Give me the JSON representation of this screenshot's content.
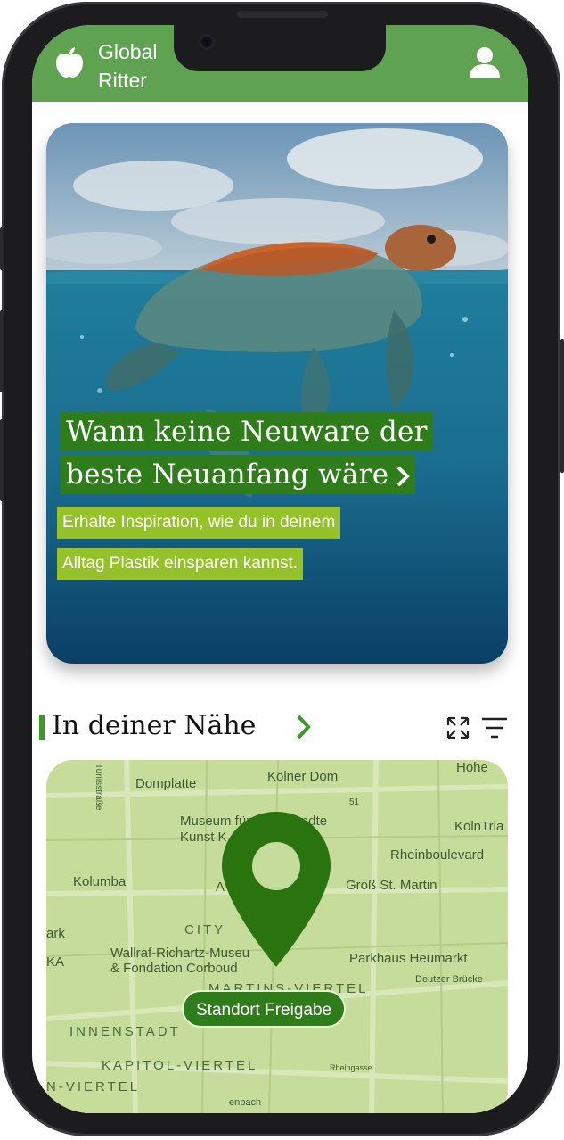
{
  "app": {
    "title_line1": "Global",
    "title_line2": "Ritter"
  },
  "icons": {
    "logo": "apple-icon",
    "profile": "user-icon",
    "hero_more": "chevron-right-icon",
    "section_more": "chevron-right-icon",
    "expand": "expand-icon",
    "filter": "filter-icon",
    "location": "map-pin-icon"
  },
  "hero": {
    "title_line1": "Wann keine Neuware der",
    "title_line2": "beste Neuanfang wäre",
    "subtitle_line1": "Erhalte Inspiration, wie du in deinem",
    "subtitle_line2": "Alltag Plastik einsparen kannst."
  },
  "section": {
    "title": "In deiner Nähe"
  },
  "map": {
    "labels": {
      "domplatte": "Domplatte",
      "koelner_dom": "Kölner Dom",
      "museum1": "Museum für",
      "museum1b": "vandte",
      "museum2": "Kunst K",
      "koelntri": "KölnTria",
      "rheinboulevard": "Rheinboulevard",
      "kolumba": "Kolumba",
      "altmarkt": "A",
      "altmarkt2": "arkt",
      "gross_st_martin": "Groß St. Martin",
      "city": "CITY",
      "mark": "ark",
      "wallraf1": "Wallraf-Richartz-Museu",
      "wallraf2": "& Fondation Corboud",
      "parkhaus": "Parkhaus Heumarkt",
      "martins": "MARTINS-VIERTEL",
      "deutzer": "Deutzer Brücke",
      "innenstadt": "INNENSTADT",
      "kapitol": "KAPITOL-VIERTEL",
      "n_viertel": "N-VIERTEL",
      "hohe": "Hohe",
      "tunis": "Tunisstraße",
      "ka": "KA",
      "n51": "51",
      "enbach": "enbach",
      "rheingasse": "Rheingasse"
    },
    "share_button": "Standort Freigabe"
  },
  "colors": {
    "header": "#5fa352",
    "title_bg": "#2e7d1a",
    "subtitle_bg": "#95c12a",
    "map_bg": "#c6dc9a",
    "accent": "#2e7d1a"
  }
}
